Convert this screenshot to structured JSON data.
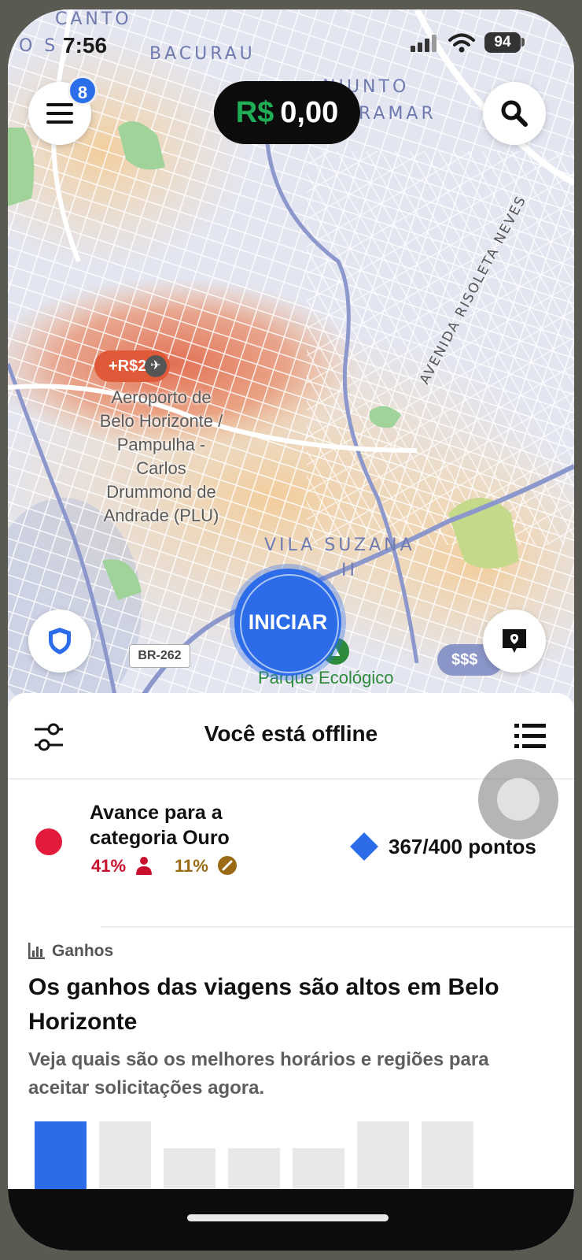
{
  "status_bar": {
    "time": "7:56",
    "battery": "94"
  },
  "map": {
    "labels": {
      "canto": "CANTO",
      "canto2": "O S",
      "bacurau": "BACURAU",
      "conjunto": "NJUNTO",
      "miramar": "RAMAR",
      "vila_suzana": "VILA SUZANA",
      "vila_suzana_2": "II",
      "avenida": "AVENIDA RISOLETA NEVES"
    },
    "airport": "Aeroporto de\nBelo Horizonte /\nPampulha -\nCarlos\nDrummond de\nAndrade (PLU)",
    "surge_tag": "+R$2",
    "road_shield": "BR-262",
    "price_pill": "$$$",
    "park": "Parque Ecológico"
  },
  "header": {
    "menu_badge": "8",
    "earnings_currency": "R$",
    "earnings_value": "0,00"
  },
  "start_button": "INICIAR",
  "sheet": {
    "status_title": "Você está offline",
    "promo": {
      "title": "Avance para a categoria Ouro",
      "stat_acceptance": "41%",
      "stat_cancel": "11%",
      "points": "367/400 pontos"
    },
    "card": {
      "tag": "Ganhos",
      "title": "Os ganhos das viagens são altos em Belo Horizonte",
      "subtitle": "Veja quais são os melhores horários e regiões para aceitar solicitações agora."
    }
  },
  "colors": {
    "accent": "#2d6ce8",
    "earnings_green": "#1fae55",
    "promo_red": "#e21b3c",
    "surge": "#e05a3a"
  },
  "icons": [
    "menu-icon",
    "search-icon",
    "shield-icon",
    "map-pin-icon",
    "filter-icon",
    "list-icon",
    "person-icon",
    "cancel-icon",
    "chart-icon",
    "diamond-icon",
    "plane-icon",
    "tree-icon"
  ]
}
